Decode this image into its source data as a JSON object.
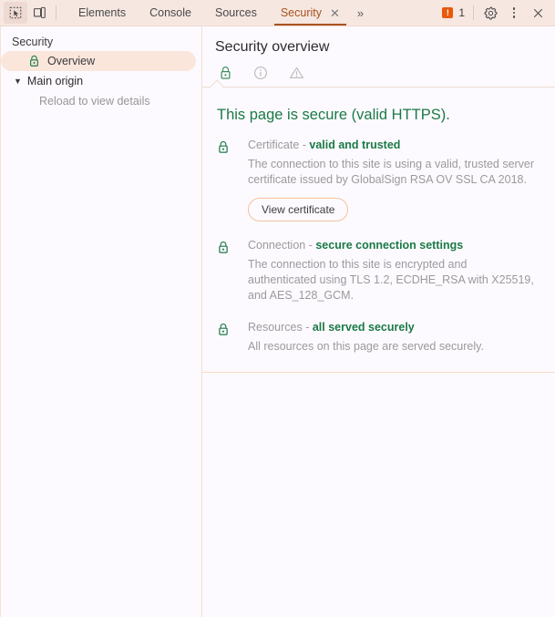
{
  "toolbar": {
    "inspect_icon": "inspect-element-icon",
    "device_icon": "device-toolbar-icon",
    "tabs": [
      {
        "label": "Elements",
        "active": false
      },
      {
        "label": "Console",
        "active": false
      },
      {
        "label": "Sources",
        "active": false
      },
      {
        "label": "Security",
        "active": true
      }
    ],
    "close_tab_label": "✕",
    "more_tabs_label": "»",
    "error_badge": {
      "symbol": "!",
      "count": "1"
    },
    "settings_icon": "gear-icon",
    "menu_icon": "kebab-menu-icon",
    "close_label": "✕",
    "accent_color": "#a8521d",
    "background_color": "#f6e7e1",
    "error_color": "#e8590c"
  },
  "sidebar": {
    "title": "Security",
    "overview": {
      "label": "Overview",
      "icon": "lock-icon",
      "selected": true
    },
    "group": {
      "label": "Main origin",
      "caret": "▼"
    },
    "sub_item": "Reload to view details"
  },
  "main": {
    "title": "Security overview",
    "status_icons": [
      {
        "name": "lock-icon",
        "state": "secure"
      },
      {
        "name": "info-icon",
        "state": "inactive"
      },
      {
        "name": "warning-icon",
        "state": "inactive"
      }
    ],
    "summary": "This page is secure (valid HTTPS).",
    "secure_color": "#1a7a46",
    "sections": [
      {
        "icon": "lock-icon",
        "label": "Certificate - ",
        "status": "valid and trusted",
        "description": "The connection to this site is using a valid, trusted server certificate issued by GlobalSign RSA OV SSL CA 2018.",
        "button": "View certificate"
      },
      {
        "icon": "lock-icon",
        "label": "Connection - ",
        "status": "secure connection settings",
        "description": "The connection to this site is encrypted and authenticated using TLS 1.2, ECDHE_RSA with X25519, and AES_128_GCM."
      },
      {
        "icon": "lock-icon",
        "label": "Resources - ",
        "status": "all served securely",
        "description": "All resources on this page are served securely."
      }
    ]
  }
}
